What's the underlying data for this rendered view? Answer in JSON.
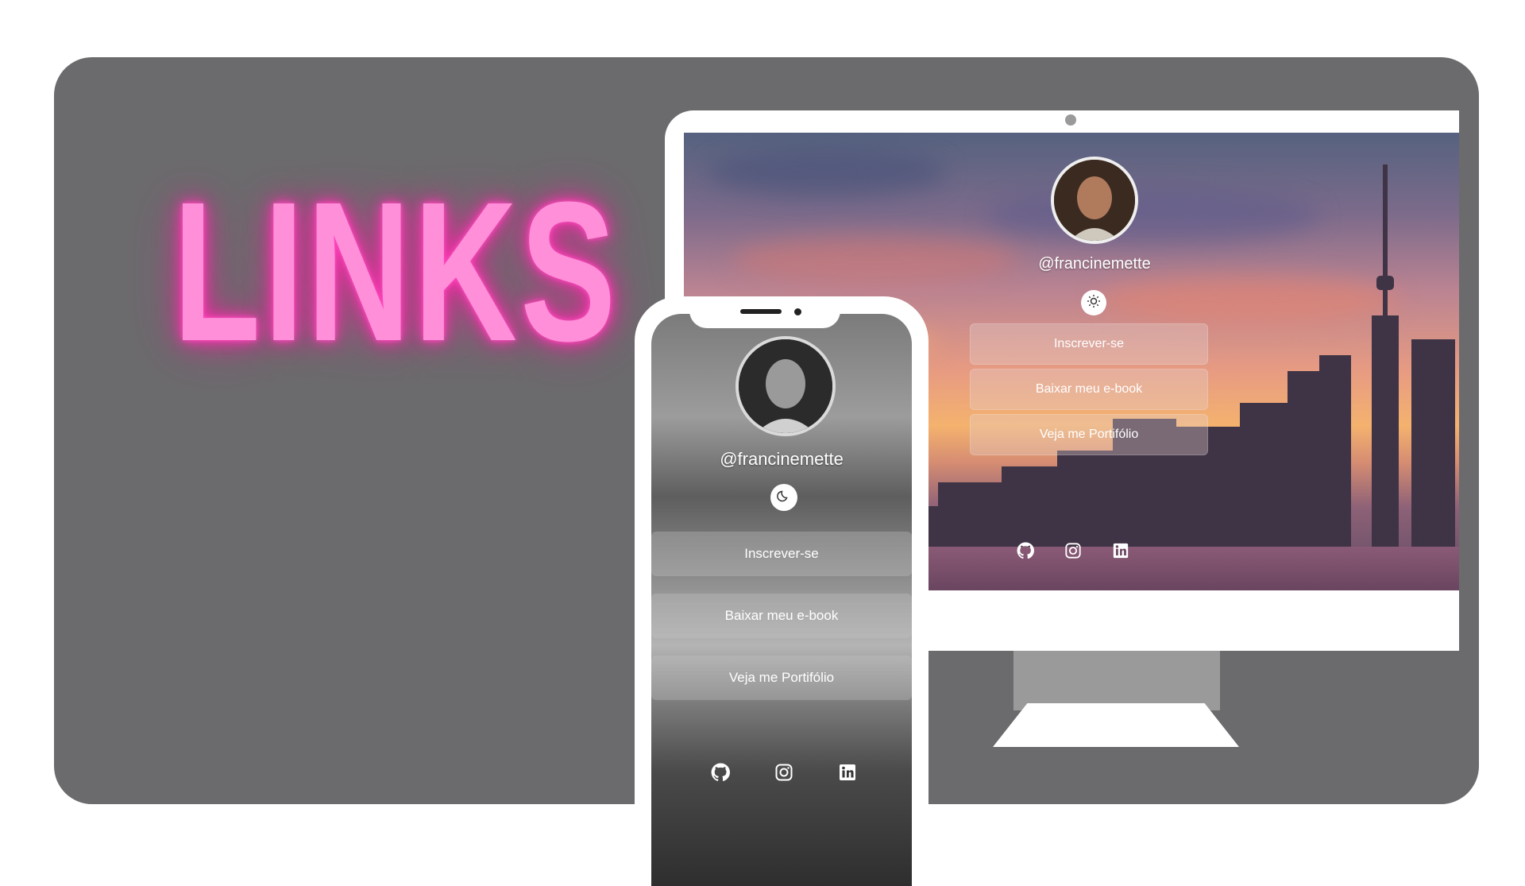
{
  "hero": {
    "title": "LINKS"
  },
  "profile": {
    "handle": "@francinemette"
  },
  "buttons": [
    "Inscrever-se",
    "Baixar meu e-book",
    "Veja me Portifólio"
  ],
  "theme_toggle": {
    "desktop_icon": "sun-icon",
    "mobile_icon": "moon-icon"
  },
  "social": [
    "github-icon",
    "instagram-icon",
    "linkedin-icon"
  ],
  "colors": {
    "neon": "#ff8fd8",
    "neon_glow": "#f0209d",
    "background_panel": "#6b6b6d"
  }
}
